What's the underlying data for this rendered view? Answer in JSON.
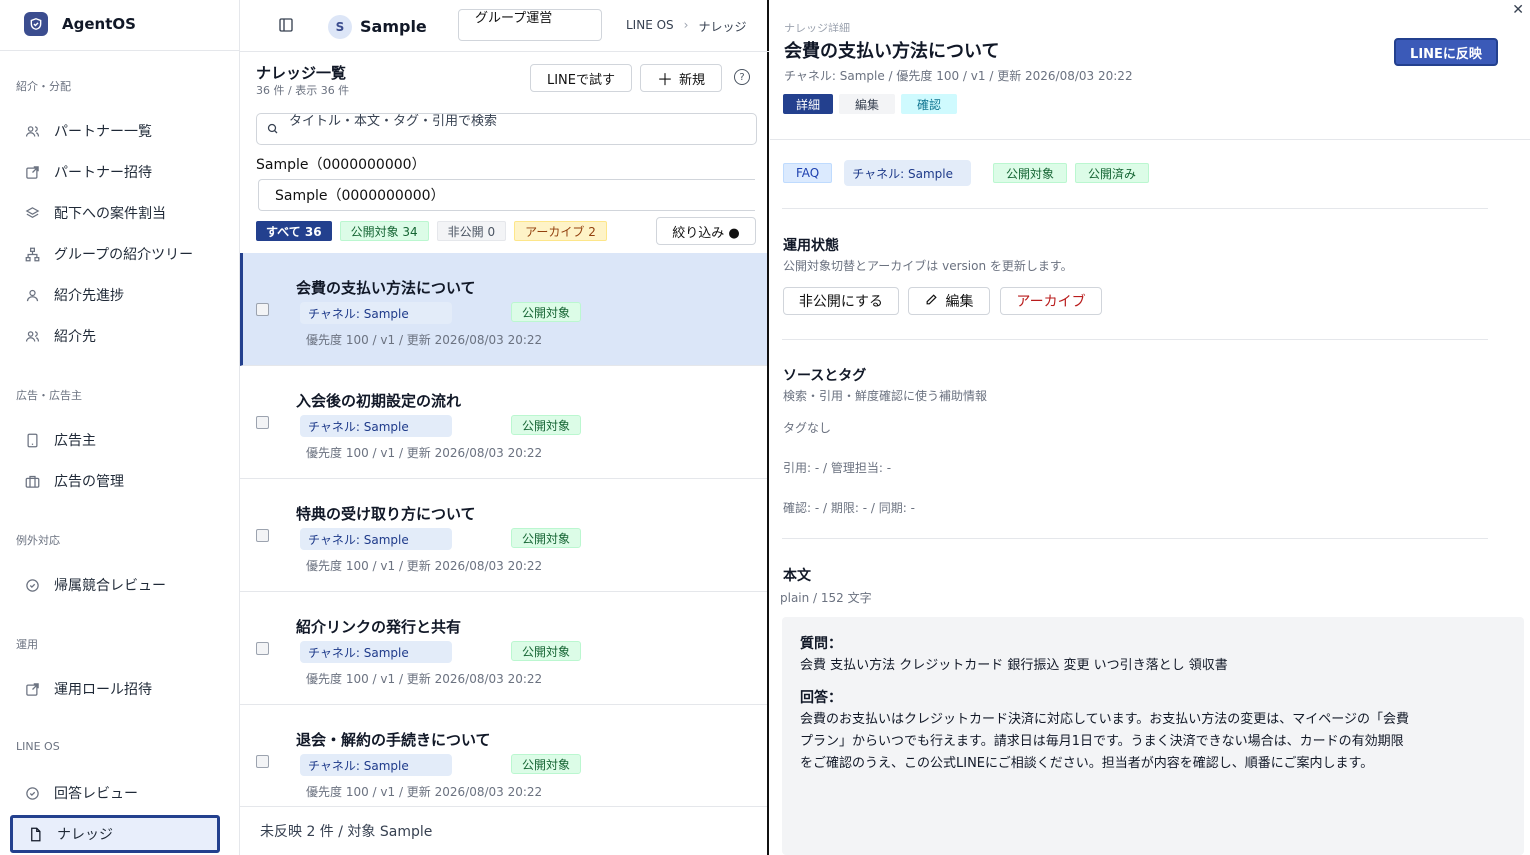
{
  "brand": {
    "name": "AgentOS"
  },
  "sidebar": {
    "groups": [
      {
        "label": "紹介・分配"
      },
      {
        "label": "広告・広告主"
      },
      {
        "label": "例外対応"
      },
      {
        "label": "運用"
      },
      {
        "label": "LINE OS"
      }
    ],
    "items": [
      {
        "label": "パートナー一覧",
        "icon": "users-icon"
      },
      {
        "label": "パートナー招待",
        "icon": "external-link-icon"
      },
      {
        "label": "配下への案件割当",
        "icon": "layers-icon"
      },
      {
        "label": "グループの紹介ツリー",
        "icon": "tree-icon"
      },
      {
        "label": "紹介先進捗",
        "icon": "user-icon"
      },
      {
        "label": "紹介先",
        "icon": "users-icon"
      },
      {
        "label": "広告主",
        "icon": "tablet-icon"
      },
      {
        "label": "広告の管理",
        "icon": "briefcase-icon"
      },
      {
        "label": "帰属競合レビュー",
        "icon": "check-circle-icon"
      },
      {
        "label": "運用ロール招待",
        "icon": "external-link-icon"
      },
      {
        "label": "回答レビュー",
        "icon": "check-circle-icon"
      },
      {
        "label": "ナレッジ",
        "icon": "file-icon"
      }
    ]
  },
  "topbar": {
    "avatar_letter": "S",
    "workspace": "Sample",
    "group": "グループ運営",
    "breadcrumb": [
      "LINE OS",
      "ナレッジ"
    ]
  },
  "list": {
    "title": "ナレッジ一覧",
    "count": "36 件 / 表示 36 件",
    "try_line": "LINEで試す",
    "new_button": "新規",
    "search_placeholder": "タイトル・本文・タグ・引用で検索",
    "channel_label": "Sample（0000000000）",
    "channel_value": "Sample（0000000000）",
    "filters": {
      "all": "すべて 36",
      "public": "公開対象 34",
      "private": "非公開 0",
      "archive": "アーカイブ 2"
    },
    "narrow": "絞り込み ●",
    "rows": [
      {
        "title": "会費の支払い方法について",
        "channel": "チャネル: Sample",
        "status": "公開対象",
        "meta": "優先度 100 / v1 / 更新 2026/08/03 20:22"
      },
      {
        "title": "入会後の初期設定の流れ",
        "channel": "チャネル: Sample",
        "status": "公開対象",
        "meta": "優先度 100 / v1 / 更新 2026/08/03 20:22"
      },
      {
        "title": "特典の受け取り方について",
        "channel": "チャネル: Sample",
        "status": "公開対象",
        "meta": "優先度 100 / v1 / 更新 2026/08/03 20:22"
      },
      {
        "title": "紹介リンクの発行と共有",
        "channel": "チャネル: Sample",
        "status": "公開対象",
        "meta": "優先度 100 / v1 / 更新 2026/08/03 20:22"
      },
      {
        "title": "退会・解約の手続きについて",
        "channel": "チャネル: Sample",
        "status": "公開対象",
        "meta": "優先度 100 / v1 / 更新 2026/08/03 20:22"
      }
    ],
    "footer": "未反映 2 件 / 対象 Sample"
  },
  "detail": {
    "eyebrow": "ナレッジ詳細",
    "title": "会費の支払い方法について",
    "meta": "チャネル: Sample / 優先度 100 / v1 / 更新 2026/08/03 20:22",
    "line_button": "LINEに反映",
    "tabs": {
      "detail": "詳細",
      "edit": "編集",
      "confirm": "確認"
    },
    "tags": {
      "faq": "FAQ",
      "channel": "チャネル: Sample",
      "public": "公開対象",
      "published": "公開済み"
    },
    "ops": {
      "title": "運用状態",
      "subtitle": "公開対象切替とアーカイブは version を更新します。",
      "private_btn": "非公開にする",
      "edit_btn": "編集",
      "archive_btn": "アーカイブ"
    },
    "source": {
      "title": "ソースとタグ",
      "subtitle": "検索・引用・鮮度確認に使う補助情報",
      "tags": "タグなし",
      "cite": "引用: - / 管理担当: -",
      "confirm": "確認: - / 期限: - / 同期: -"
    },
    "body": {
      "title": "本文",
      "format": "plain / 152 文字",
      "q_label": "質問：",
      "q_text": "会費 支払い方法 クレジットカード 銀行振込 変更 いつ引き落とし 領収書",
      "a_label": "回答：",
      "a_text": "会費のお支払いはクレジットカード決済に対応しています。お支払い方法の変更は、マイページの「会費プラン」からいつでも行えます。請求日は毎月1日です。うまく決済できない場合は、カードの有効期限をご確認のうえ、この公式LINEにご相談ください。担当者が内容を確認し、順番にご案内します。"
    }
  }
}
